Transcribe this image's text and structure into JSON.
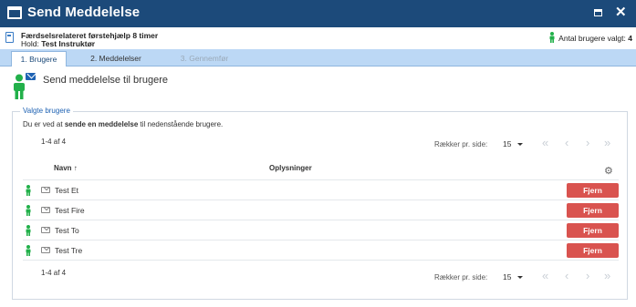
{
  "window": {
    "title": "Send Meddelelse",
    "maximize_icon": "maximize-icon",
    "close_icon": "close-icon",
    "close_glyph": "✕"
  },
  "info": {
    "course_title": "Færdselsrelateret førstehjælp 8 timer",
    "team_label": "Hold:",
    "team_value": "Test Instruktør",
    "users_selected_label": "Antal brugere valgt:",
    "users_selected_count": "4"
  },
  "tabs": [
    {
      "label": "1. Brugere",
      "state": "active"
    },
    {
      "label": "2. Meddelelser",
      "state": "enabled"
    },
    {
      "label": "3. Gennemfør",
      "state": "disabled"
    }
  ],
  "heading": {
    "text": "Send meddelelse til brugere"
  },
  "section": {
    "legend": "Valgte brugere",
    "intro_before": "Du er ved at ",
    "intro_bold": "sende en meddelelse",
    "intro_after": " til nedenstående brugere."
  },
  "pagination_top": {
    "count": "1-4 af 4",
    "rows_label": "Rækker pr. side:",
    "rows_value": "15"
  },
  "pagination_bottom": {
    "count": "1-4 af 4",
    "rows_label": "Rækker pr. side:",
    "rows_value": "15"
  },
  "pager_glyphs": {
    "first": "«",
    "prev": "‹",
    "next": "›",
    "last": "»"
  },
  "table": {
    "columns": {
      "name": "Navn",
      "sort_glyph": "↑",
      "info": "Oplysninger"
    },
    "settings_glyph": "⚙",
    "rows": [
      {
        "name": "Test Et",
        "action": "Fjern"
      },
      {
        "name": "Test Fire",
        "action": "Fjern"
      },
      {
        "name": "Test To",
        "action": "Fjern"
      },
      {
        "name": "Test Tre",
        "action": "Fjern"
      }
    ]
  },
  "colors": {
    "titlebar": "#1c4a7a",
    "tabbar": "#bcd8f5",
    "person": "#22b04a",
    "remove": "#d9534f",
    "accent": "#1e62b3"
  }
}
